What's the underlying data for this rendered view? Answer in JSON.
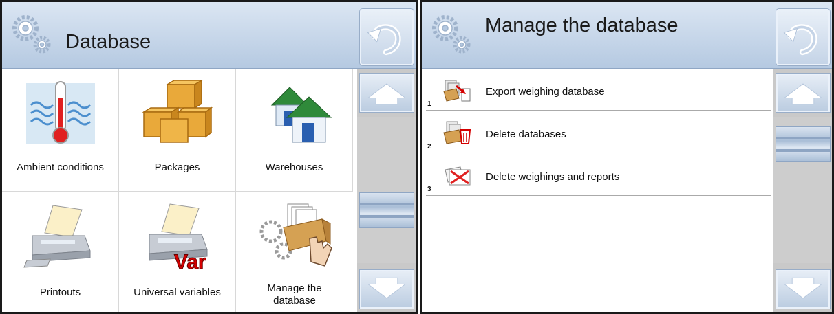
{
  "left": {
    "title": "Database",
    "tiles": [
      {
        "label": "Ambient conditions",
        "icon": "thermometer-icon"
      },
      {
        "label": "Packages",
        "icon": "boxes-icon"
      },
      {
        "label": "Warehouses",
        "icon": "houses-icon"
      },
      {
        "label": "Printouts",
        "icon": "printer-icon"
      },
      {
        "label": "Universal variables",
        "icon": "printer-var-icon",
        "badge": "Var"
      },
      {
        "label_line1": "Manage the",
        "label_line2": "database",
        "icon": "database-drawer-hand-icon"
      }
    ]
  },
  "right": {
    "title": "Manage the database",
    "items": [
      {
        "num": "1",
        "label": "Export weighing database",
        "icon": "export-database-icon"
      },
      {
        "num": "2",
        "label": "Delete databases",
        "icon": "delete-database-icon"
      },
      {
        "num": "3",
        "label": "Delete weighings and reports",
        "icon": "delete-reports-icon"
      }
    ]
  },
  "colors": {
    "header": "#b5c9e1",
    "scrollbar": "#c9c9c9",
    "accent_red": "#d40000"
  }
}
